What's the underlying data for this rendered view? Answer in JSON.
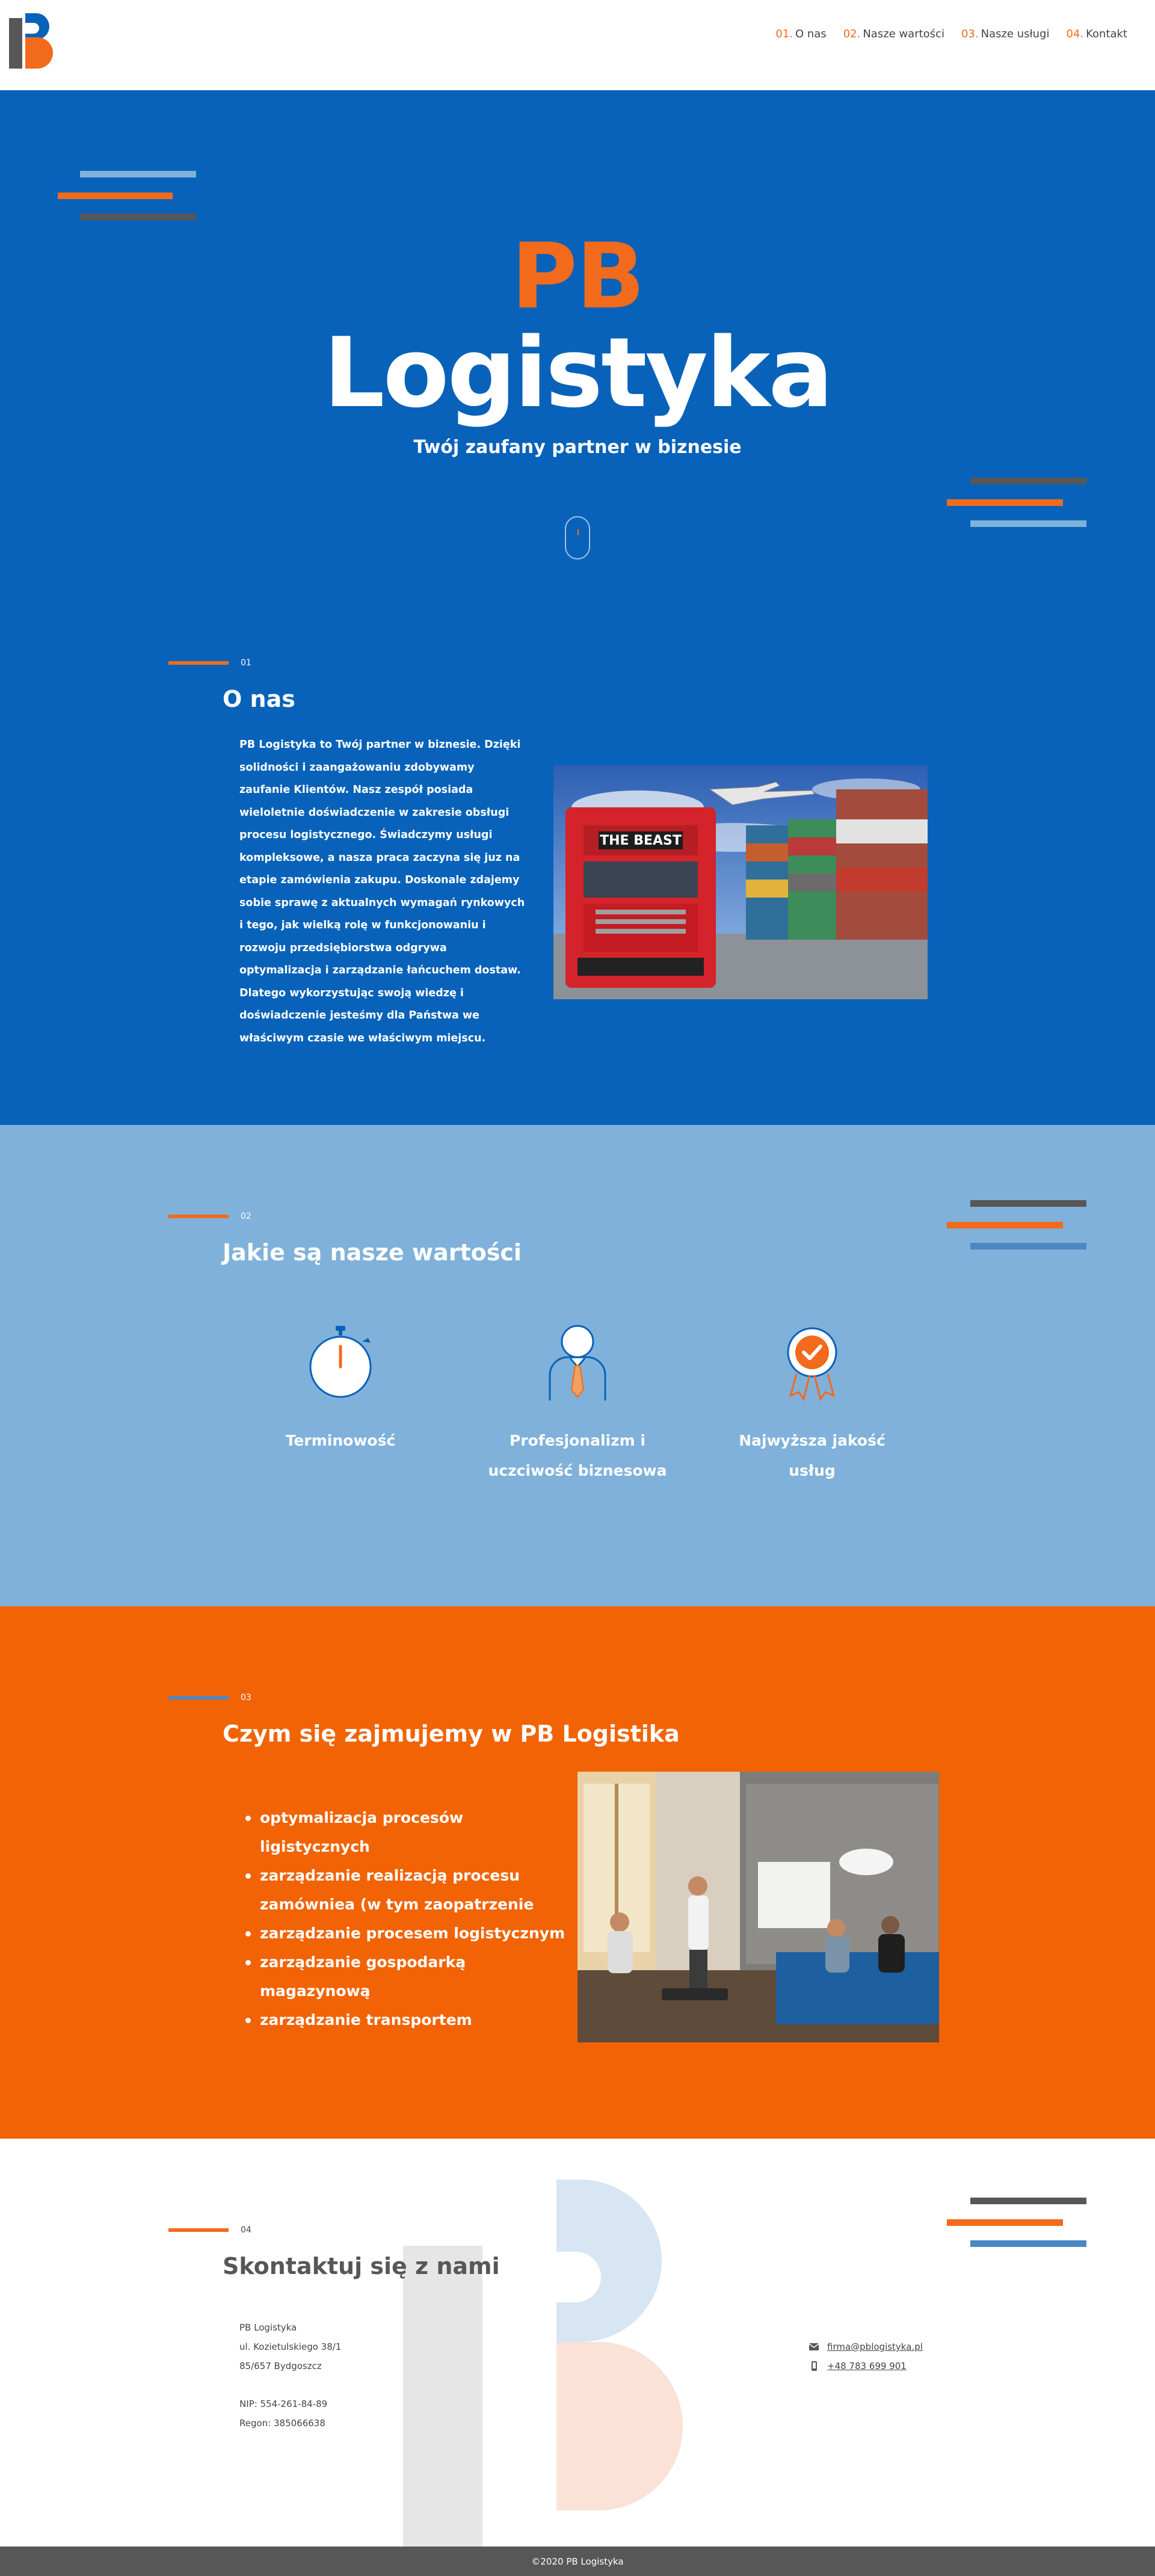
{
  "colors": {
    "brand_orange": "#f26a1b",
    "brand_blue": "#0862b9",
    "light_blue": "#7fb1da",
    "dark_gray": "#575757"
  },
  "header": {
    "logo_icon": "pb-logo-icon",
    "nav": [
      {
        "num": "01.",
        "label": "O nas"
      },
      {
        "num": "02.",
        "label": "Nasze wartości"
      },
      {
        "num": "03.",
        "label": "Nasze usługi"
      },
      {
        "num": "04.",
        "label": "Kontakt"
      }
    ]
  },
  "hero": {
    "title_pb": "PB",
    "title_main": "Logistyka",
    "subtitle": "Twój zaufany partner w biznesie",
    "scroll_icon": "mouse-scroll-icon"
  },
  "about": {
    "num": "01",
    "heading": "O nas",
    "text": "PB Logistyka to Twój partner w biznesie. Dzięki solidności i zaangażowaniu zdobywamy zaufanie Klientów. Nasz zespół posiada wieloletnie doświadczenie w zakresie obsługi procesu logistycznego. Świadczymy usługi kompleksowe, a nasza praca zaczyna się juz na etapie zamówienia zakupu. Doskonale zdajemy sobie sprawę z aktualnych wymagań rynkowych i tego, jak wielką rolę w funkcjonowaniu i rozwoju przedsiębiorstwa odgrywa optymalizacja i zarządzanie łańcuchem dostaw. Dlatego wykorzystując swoją wiedzę i doświadczenie jesteśmy dla Państwa we właściwym czasie we właściwym miejscu.",
    "image_text": "THE BEAST"
  },
  "values": {
    "num": "02",
    "heading": "Jakie są nasze wartości",
    "items": [
      {
        "icon": "stopwatch-icon",
        "label": "Terminowość"
      },
      {
        "icon": "businessman-icon",
        "label": "Profesjonalizm i uczciwość biznesowa"
      },
      {
        "icon": "quality-badge-icon",
        "label": "Najwyższa jakość usług"
      }
    ]
  },
  "services": {
    "num": "03",
    "heading": "Czym się zajmujemy w PB Logistika",
    "items": [
      "optymalizacja procesów ligistycznych",
      "zarządzanie realizacją procesu zamówniea (w tym zaopatrzenie",
      "zarządzanie procesem logistycznym",
      "zarządzanie gospodarką magazynową",
      "zarządzanie transportem"
    ]
  },
  "contact": {
    "num": "04",
    "heading": "Skontaktuj się z nami",
    "address": [
      "PB Logistyka",
      "ul. Kozietulskiego 38/1",
      "85/657 Bydgoszcz"
    ],
    "ids": [
      "NIP: 554-261-84-89",
      "Regon: 385066638"
    ],
    "email_icon": "envelope-icon",
    "email": "firma@pblogistyka.pl",
    "phone_icon": "phone-icon",
    "phone": "+48 783 699 901"
  },
  "footer": {
    "copyright": "©2020 PB Logistyka"
  }
}
